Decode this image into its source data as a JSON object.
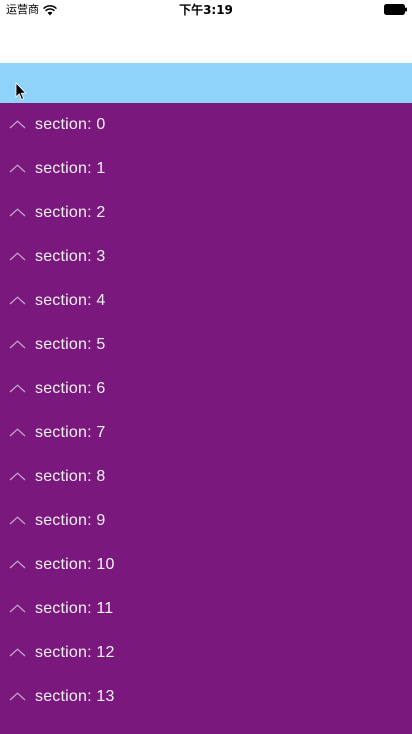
{
  "status_bar": {
    "carrier": "运营商",
    "time": "下午3:19",
    "wifi_icon": "wifi-icon",
    "battery_icon": "battery-icon"
  },
  "header": {
    "background": "#8fd3fb",
    "cursor_icon": "cursor-icon"
  },
  "list": {
    "background": "#7b187e",
    "text_color": "#f2f2f2",
    "expand_icon": "chevron-up-icon",
    "items": [
      {
        "label": "section: 0"
      },
      {
        "label": "section: 1"
      },
      {
        "label": "section: 2"
      },
      {
        "label": "section: 3"
      },
      {
        "label": "section: 4"
      },
      {
        "label": "section: 5"
      },
      {
        "label": "section: 6"
      },
      {
        "label": "section: 7"
      },
      {
        "label": "section: 8"
      },
      {
        "label": "section: 9"
      },
      {
        "label": "section: 10"
      },
      {
        "label": "section: 11"
      },
      {
        "label": "section: 12"
      },
      {
        "label": "section: 13"
      }
    ]
  }
}
